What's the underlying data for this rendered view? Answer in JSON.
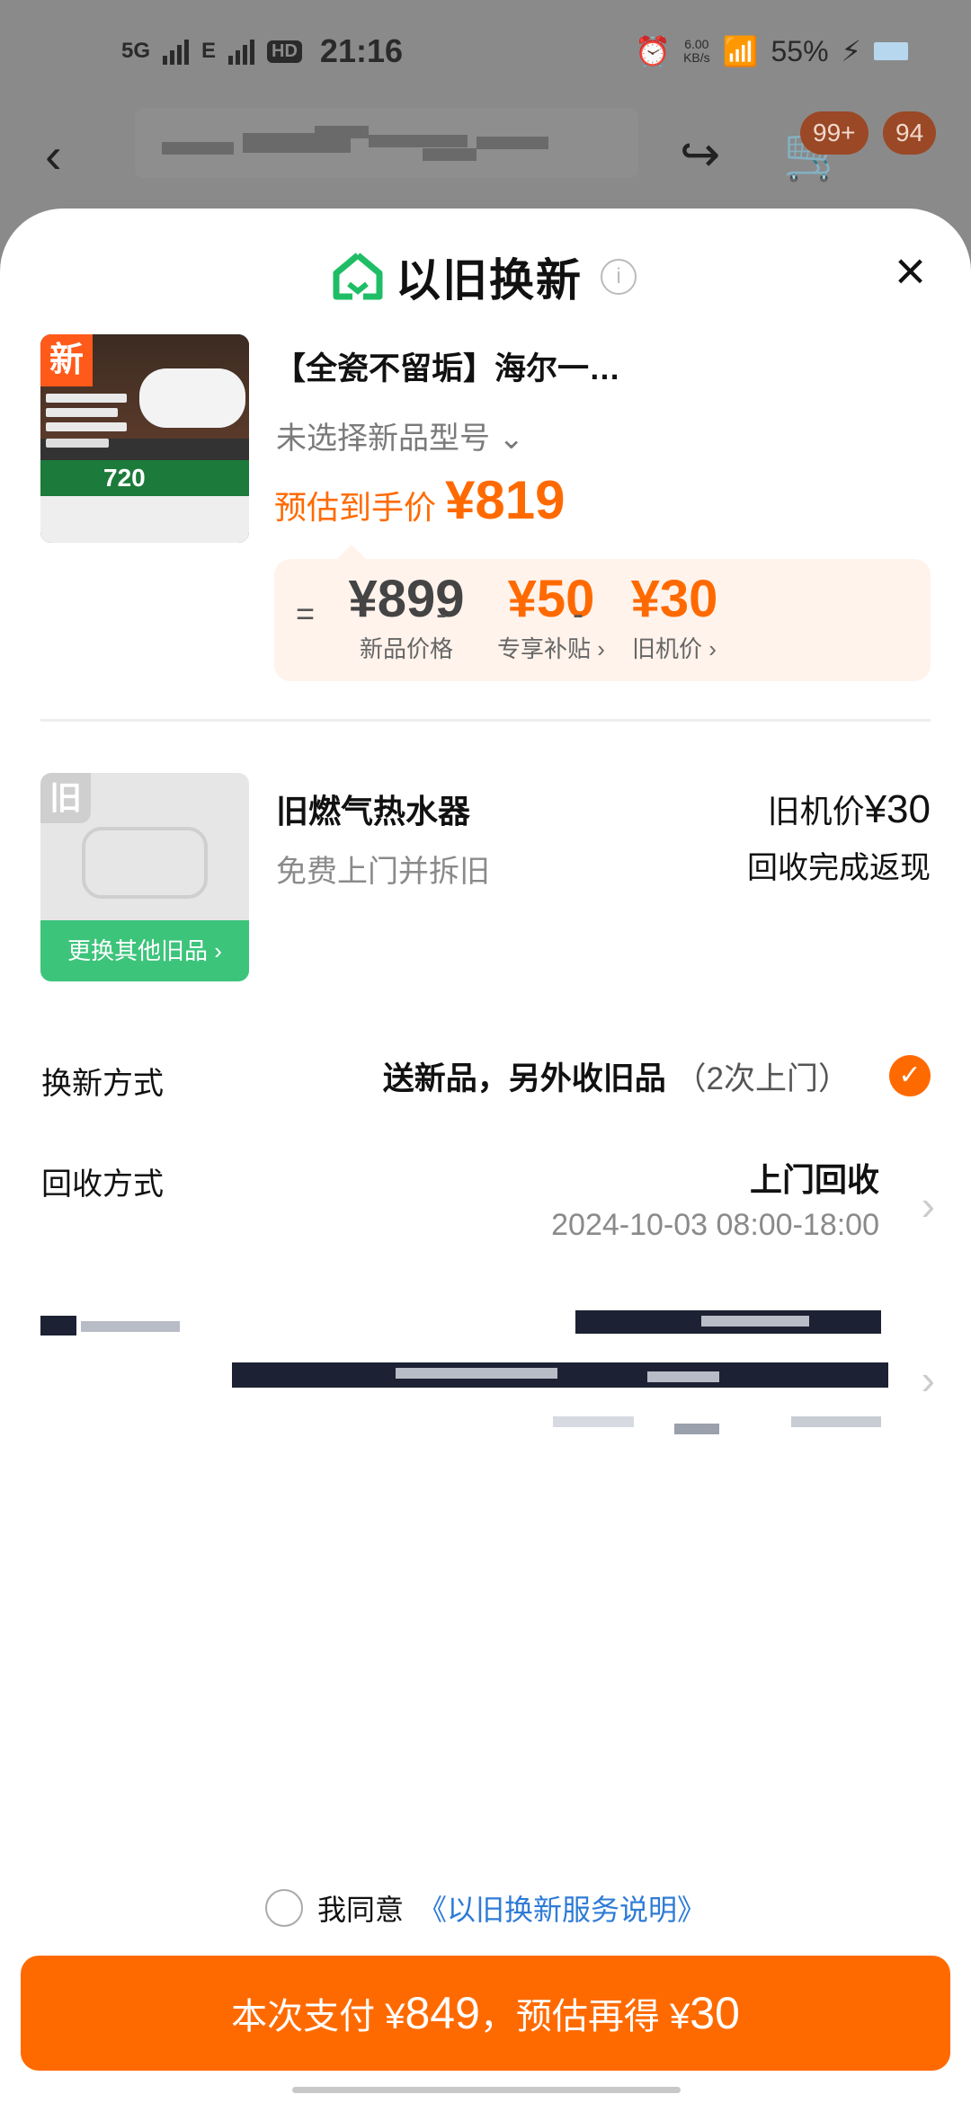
{
  "status_bar": {
    "net1": "5G",
    "net2": "E",
    "hd": "HD",
    "time": "21:16",
    "speed_value": "6.00",
    "speed_unit": "KB/s",
    "battery": "55%"
  },
  "nav": {
    "back_icon": "back-chevron-icon",
    "share_icon": "share-icon",
    "cart_icon": "cart-icon",
    "cart_badge": "99+",
    "msg_badge": "94"
  },
  "sheet": {
    "title": "以旧换新",
    "info_icon": "i",
    "close_icon": "×",
    "product": {
      "image_badge": "新",
      "image_band_text": "720",
      "title": "【全瓷不留垢】海尔一…",
      "model_placeholder": "未选择新品型号",
      "est_label": "预估到手价",
      "est_currency": "¥",
      "est_price": "819"
    },
    "calc": {
      "eq": "=",
      "minus": "-",
      "new_price": "¥899",
      "new_price_label": "新品价格",
      "subsidy": "¥50",
      "subsidy_label": "专享补贴 ›",
      "old_price": "¥30",
      "old_price_label": "旧机价 ›"
    },
    "old_item": {
      "tag": "旧",
      "swap_label": "更换其他旧品 ›",
      "name": "旧燃气热水器",
      "service": "免费上门并拆旧",
      "price_label": "旧机价",
      "price": "¥30",
      "cashback": "回收完成返现"
    },
    "exchange": {
      "label": "换新方式",
      "value": "送新品，另外收旧品",
      "visits": "（2次上门）",
      "check": "✓"
    },
    "recycle": {
      "label": "回收方式",
      "value": "上门回收",
      "time": "2024-10-03 08:00-18:00",
      "chevron": "›"
    },
    "agreement": {
      "prefix": "我同意",
      "link": "《以旧换新服务说明》"
    },
    "pay_button": {
      "prefix": "本次支付 ¥",
      "amount": "849",
      "middle": "，预估再得 ¥",
      "bonus": "30"
    }
  },
  "colors": {
    "accent": "#ff6a00",
    "green": "#3cc47b",
    "link": "#2e7bd6"
  }
}
